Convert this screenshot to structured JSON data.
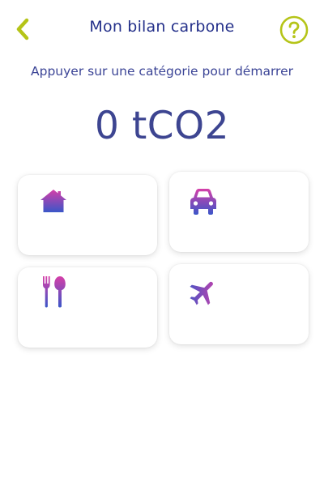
{
  "header": {
    "title": "Mon bilan carbone",
    "back_icon": "chevron-left-icon",
    "help_icon": "question-circle-icon"
  },
  "instruction": "Appuyer sur une catégorie pour démarrer",
  "total": "0 tCO2",
  "categories": [
    {
      "icon": "home-icon"
    },
    {
      "icon": "car-icon"
    },
    {
      "icon": "food-icon"
    },
    {
      "icon": "plane-icon"
    }
  ],
  "colors": {
    "accent": "#b5c418",
    "title": "#24308a",
    "gradient_top": "#d63fa8",
    "gradient_bottom": "#3a56c8"
  }
}
